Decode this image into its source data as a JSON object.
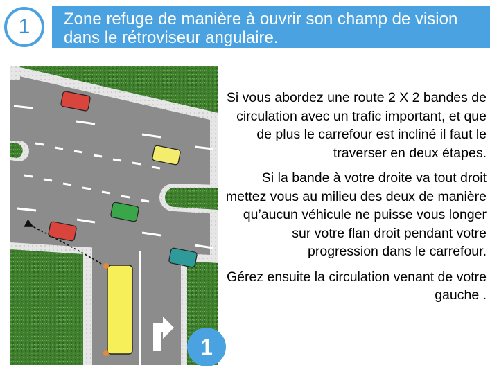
{
  "step_number": "1",
  "title": "Zone refuge de manière à ouvrir son champ de vision dans le rétroviseur angulaire.",
  "paragraphs": [
    "Si vous abordez une route 2 X 2 bandes de circulation avec un trafic important, et que de plus le carrefour est incliné il faut le traverser en deux étapes.",
    "Si la bande à votre droite va tout droit mettez vous au milieu des deux de manière qu’aucun véhicule ne puisse vous longer sur votre flan droit pendant votre progression dans le carrefour.",
    "Gérez ensuite la circulation venant de votre gauche ."
  ],
  "badge_number": "1",
  "colors": {
    "accent": "#4aa3e0",
    "grass": "#3f7f2e",
    "road": "#8c8c8c",
    "car_red": "#d9443c",
    "car_yellow": "#f4ec6c",
    "car_green": "#3aa64a",
    "car_teal": "#2f9a9a",
    "truck": "#f7ef5a"
  },
  "icons": [
    "right-turn-arrow-icon",
    "dotted-trajectory-arrow-icon"
  ]
}
